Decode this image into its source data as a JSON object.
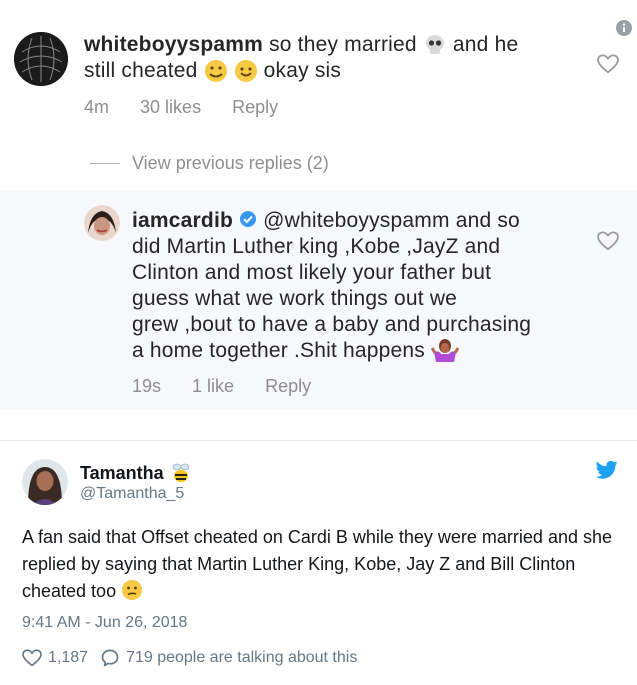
{
  "instagram": {
    "comment": {
      "username": "whiteboyyspamm",
      "text_line1": "so they married",
      "text_line1b": "and he",
      "text_line2a": "still cheated",
      "text_line2b": "okay sis",
      "time": "4m",
      "likes": "30 likes",
      "reply": "Reply"
    },
    "view_previous": "View previous replies (2)",
    "reply": {
      "username": "iamcardib",
      "line1": "@whiteboyyspamm and so",
      "line2": "did Martin Luther king ,Kobe ,JayZ and",
      "line3": "Clinton  and most likely your father but",
      "line4": "guess what we work things out we",
      "line5": "grew ,bout to have a baby and purchasing",
      "line6": "a home together .Shit happens",
      "time": "19s",
      "likes": "1 like",
      "reply": "Reply"
    }
  },
  "tweet": {
    "name": "Tamantha",
    "handle": "@Tamantha_5",
    "text": "A fan said that Offset cheated on Cardi B while they were married and she replied by saying that Martin Luther King, Kobe, Jay Z and Bill Clinton cheated too",
    "timestamp": "9:41 AM - Jun 26, 2018",
    "likes": "1,187",
    "talking": "719 people are talking about this"
  },
  "icons": {
    "brand": "#1da1f2",
    "verified": "#3897f0"
  }
}
